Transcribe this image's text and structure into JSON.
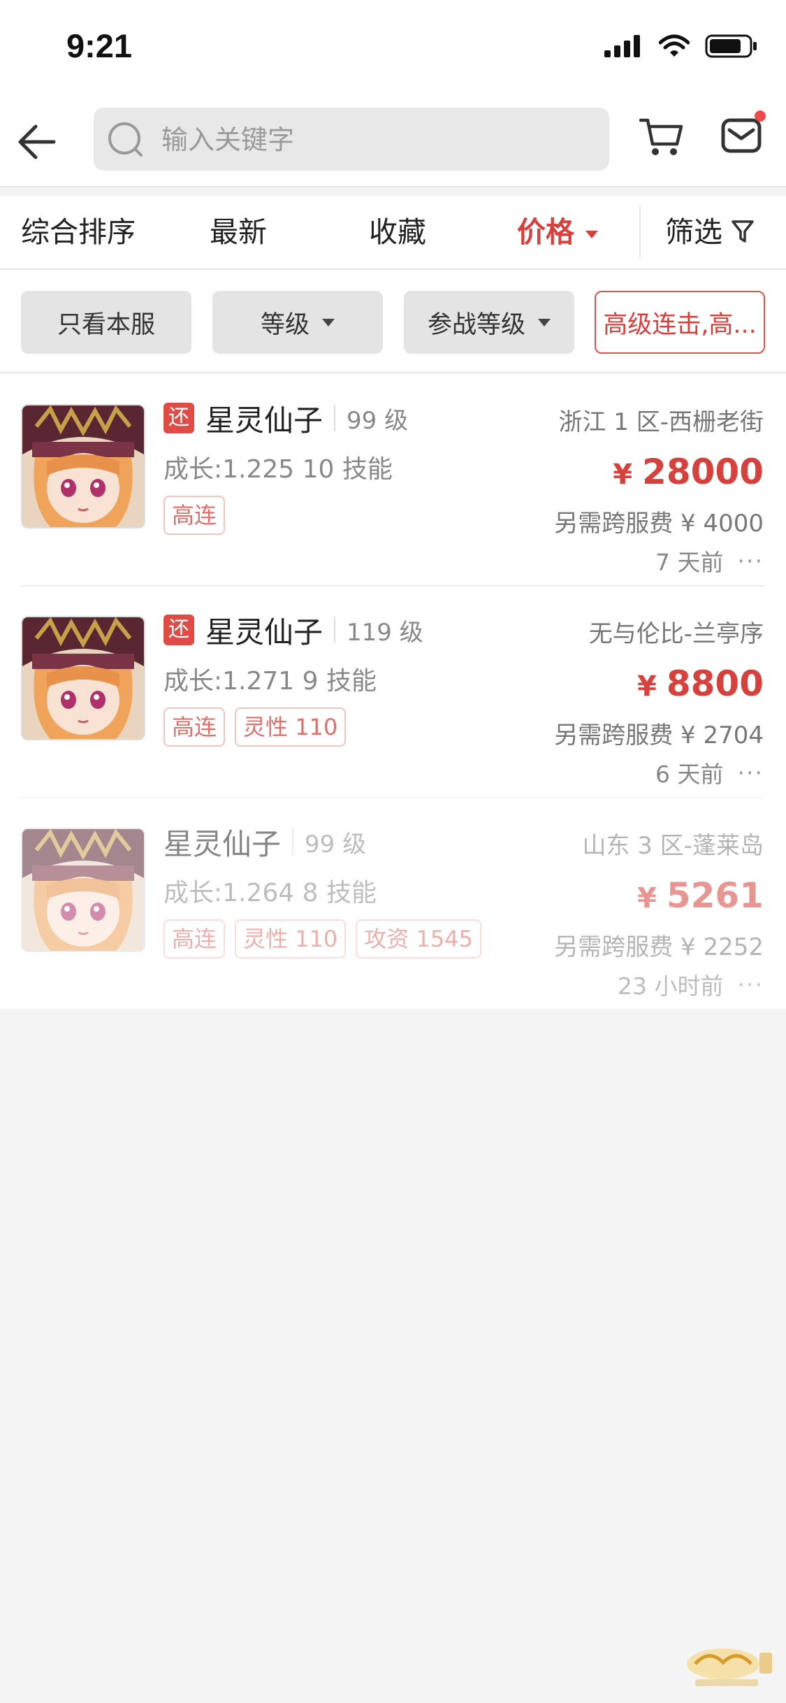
{
  "status_bar": {
    "time": "9:21"
  },
  "search": {
    "placeholder": "输入关键字"
  },
  "sort_bar": {
    "items": [
      "综合排序",
      "最新",
      "收藏",
      "价格"
    ],
    "filter_label": "筛选"
  },
  "chips": [
    "只看本服",
    "等级",
    "参战等级",
    "高级连击,高..."
  ],
  "listings": [
    {
      "badge": "还",
      "name": "星灵仙子",
      "level": "99 级",
      "growth": "成长:1.225 10 技能",
      "tags": [
        "高连"
      ],
      "server": "浙江 1 区-西栅老街",
      "currency": "¥",
      "price": "28000",
      "fee": "另需跨服费 ¥ 4000",
      "time": "7 天前"
    },
    {
      "badge": "还",
      "name": "星灵仙子",
      "level": "119 级",
      "growth": "成长:1.271 9 技能",
      "tags": [
        "高连",
        "灵性 110"
      ],
      "server": "无与伦比-兰亭序",
      "currency": "¥",
      "price": "8800",
      "fee": "另需跨服费 ¥ 2704",
      "time": "6 天前"
    },
    {
      "name": "星灵仙子",
      "level": "99 级",
      "growth": "成长:1.264 8 技能",
      "tags": [
        "高连",
        "灵性 110",
        "攻资 1545"
      ],
      "server": "山东 3 区-蓬莱岛",
      "currency": "¥",
      "price": "5261",
      "fee": "另需跨服费 ¥ 2252",
      "time": "23 小时前"
    }
  ],
  "more_glyph": "···",
  "colors": {
    "accent": "#d6413d",
    "background": "#f4f4f4"
  }
}
